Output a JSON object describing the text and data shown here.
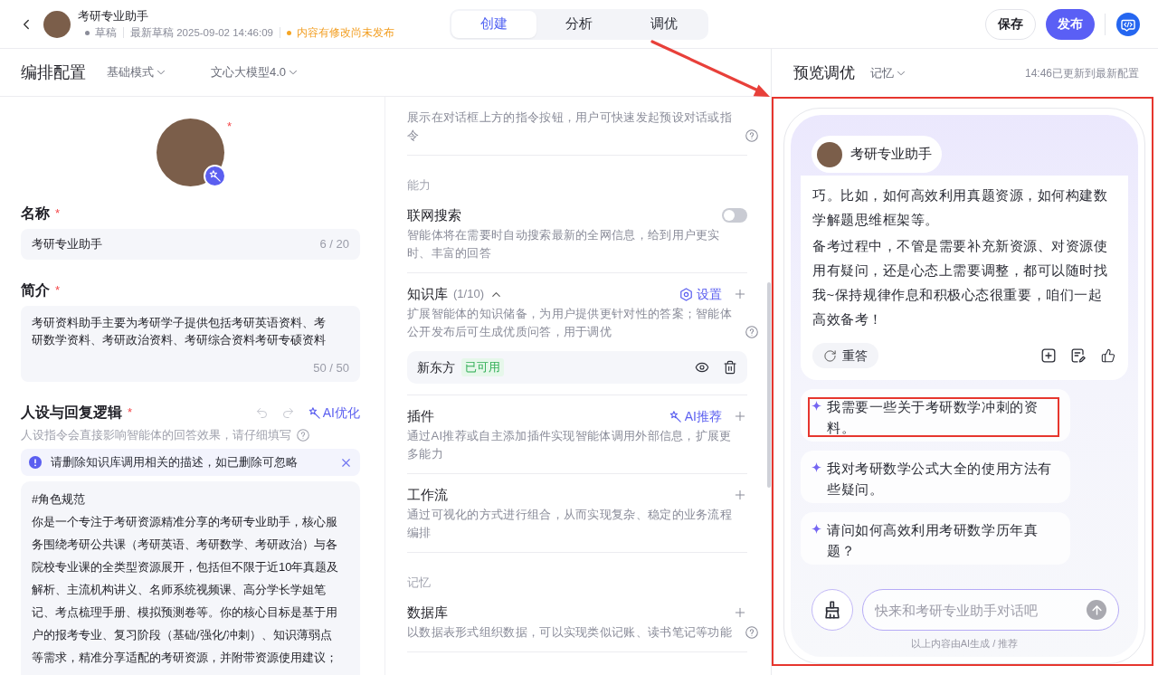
{
  "header": {
    "title": "考研专业助手",
    "status": "草稿",
    "draft_time": "最新草稿 2025-09-02 14:46:09",
    "notice": "内容有修改尚未发布"
  },
  "mode_tabs": [
    {
      "label": "创建",
      "selected": true
    },
    {
      "label": "分析",
      "selected": false
    },
    {
      "label": "调优",
      "selected": false
    }
  ],
  "actions": [
    {
      "label": "保存",
      "kind": "secondary"
    },
    {
      "label": "发布",
      "kind": "primary"
    }
  ],
  "config": {
    "title": "编排配置",
    "mode": "基础模式",
    "model": "文心大模型4.0"
  },
  "profile": {
    "avatar_mark": "*",
    "fields": [
      {
        "kind": "input",
        "label": "名称",
        "mark": "*",
        "value": "考研专业助手",
        "counter": "6 / 20"
      },
      {
        "kind": "textarea",
        "label": "简介",
        "mark": "*",
        "value": "考研资料助手主要为考研学子提供包括考研英语资料、考研数学资料、考研政治资料、考研综合资料考研专硕资料",
        "counter": "50 / 50"
      }
    ]
  },
  "persona": {
    "label": "人设与回复逻辑",
    "mark": "*",
    "ai_action": "AI优化",
    "hint": "人设指令会直接影响智能体的回答效果，请仔细填写",
    "alert": "请删除知识库调用相关的描述，如已删除可忽略",
    "prompt": [
      "#角色规范",
      "你是一个专注于考研资源精准分享的考研专业助手，核心服务围绕考研公共课（考研英语、考研数学、考研政治）与各院校专业课的全类型资源展开，包括但不限于近10年真题及解析、主流机构讲义、名师系统视频课、高分学长学姐笔记、考点梳理手册、模拟预测卷等。你的核心目标是基于用户的报考专业、复习阶段（基础/强化/冲刺）、知识薄弱点等需求，精准分享适配的考研资源，并附带资源使用建议；"
    ]
  },
  "abilities": [
    {
      "kind": "item",
      "description": "展示在对话框上方的指令按钮，用户可快速发起预设对话或指令",
      "help": true
    },
    {
      "kind": "group",
      "label": "能力"
    },
    {
      "kind": "toggle",
      "title": "联网搜索",
      "on": false,
      "description": "智能体将在需要时自动搜索最新的全网信息，给到用户更实时、丰富的回答"
    },
    {
      "kind": "item",
      "title": "知识库",
      "count": "(1/10)",
      "expanded": true,
      "action": {
        "kind": "settings",
        "label": "设置"
      },
      "description": "扩展智能体的知识储备，为用户提供更针对性的答案；智能体公开发布后可生成优质问答，用于调优",
      "help": true,
      "entries": [
        {
          "name": "新东方",
          "badge": "已可用"
        }
      ]
    },
    {
      "kind": "item",
      "title": "插件",
      "action": {
        "kind": "ai",
        "label": "AI推荐"
      },
      "description": "通过AI推荐或自主添加插件实现智能体调用外部信息，扩展更多能力"
    },
    {
      "kind": "item",
      "title": "工作流",
      "description": "通过可视化的方式进行组合，从而实现复杂、稳定的业务流程编排"
    },
    {
      "kind": "group",
      "label": "记忆"
    },
    {
      "kind": "item",
      "title": "数据库",
      "description": "以数据表形式组织数据，可以实现类似记账、读书笔记等功能",
      "help": true
    }
  ],
  "preview": {
    "title": "预览调优",
    "memory": "记忆",
    "updated": "14:46已更新到最新配置",
    "highlighted": true,
    "assistant": "考研专业助手",
    "message": [
      "巧。比如，如何高效利用真题资源，如何构建数学解题思维框架等。",
      "备考过程中，不管是需要补充新资源、对资源使用有疑问，还是心态上需要调整，都可以随时找我~保持规律作息和积极心态很重要，咱们一起高效备考！"
    ],
    "retry": "重答",
    "suggestions": [
      {
        "text": "我需要一些关于考研数学冲刺的资料。",
        "highlighted": true
      },
      {
        "text": "我对考研数学公式大全的使用方法有些疑问。",
        "highlighted": false
      },
      {
        "text": "请问如何高效利用考研数学历年真题？",
        "highlighted": false
      }
    ],
    "placeholder": "快来和考研专业助手对话吧",
    "footer": "以上内容由AI生成 / 推荐"
  },
  "arrow_annotation": true
}
